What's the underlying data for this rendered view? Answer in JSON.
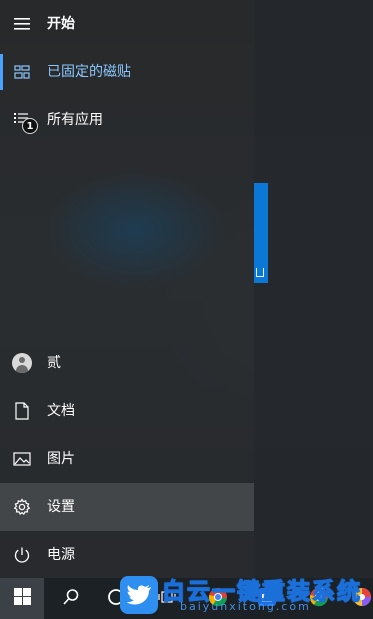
{
  "nav": {
    "header_label": "开始",
    "pinned_label": "已固定的磁贴",
    "all_apps_label": "所有应用",
    "badge": "1",
    "user_label": "贰",
    "documents_label": "文档",
    "pictures_label": "图片",
    "settings_label": "设置",
    "power_label": "电源"
  },
  "watermark": {
    "text": "白云一键重装系统",
    "url": "baiyunxitong.com"
  },
  "colors": {
    "accent": "#4aa3ff",
    "tile": "#0a78d4",
    "taskbar": "#1c2126"
  },
  "taskbar_icons": [
    "windows-icon",
    "search-icon",
    "cortana-icon",
    "task-view-icon",
    "chrome-icon",
    "store-icon",
    "chrome-icon",
    "colorful-app-icon"
  ]
}
